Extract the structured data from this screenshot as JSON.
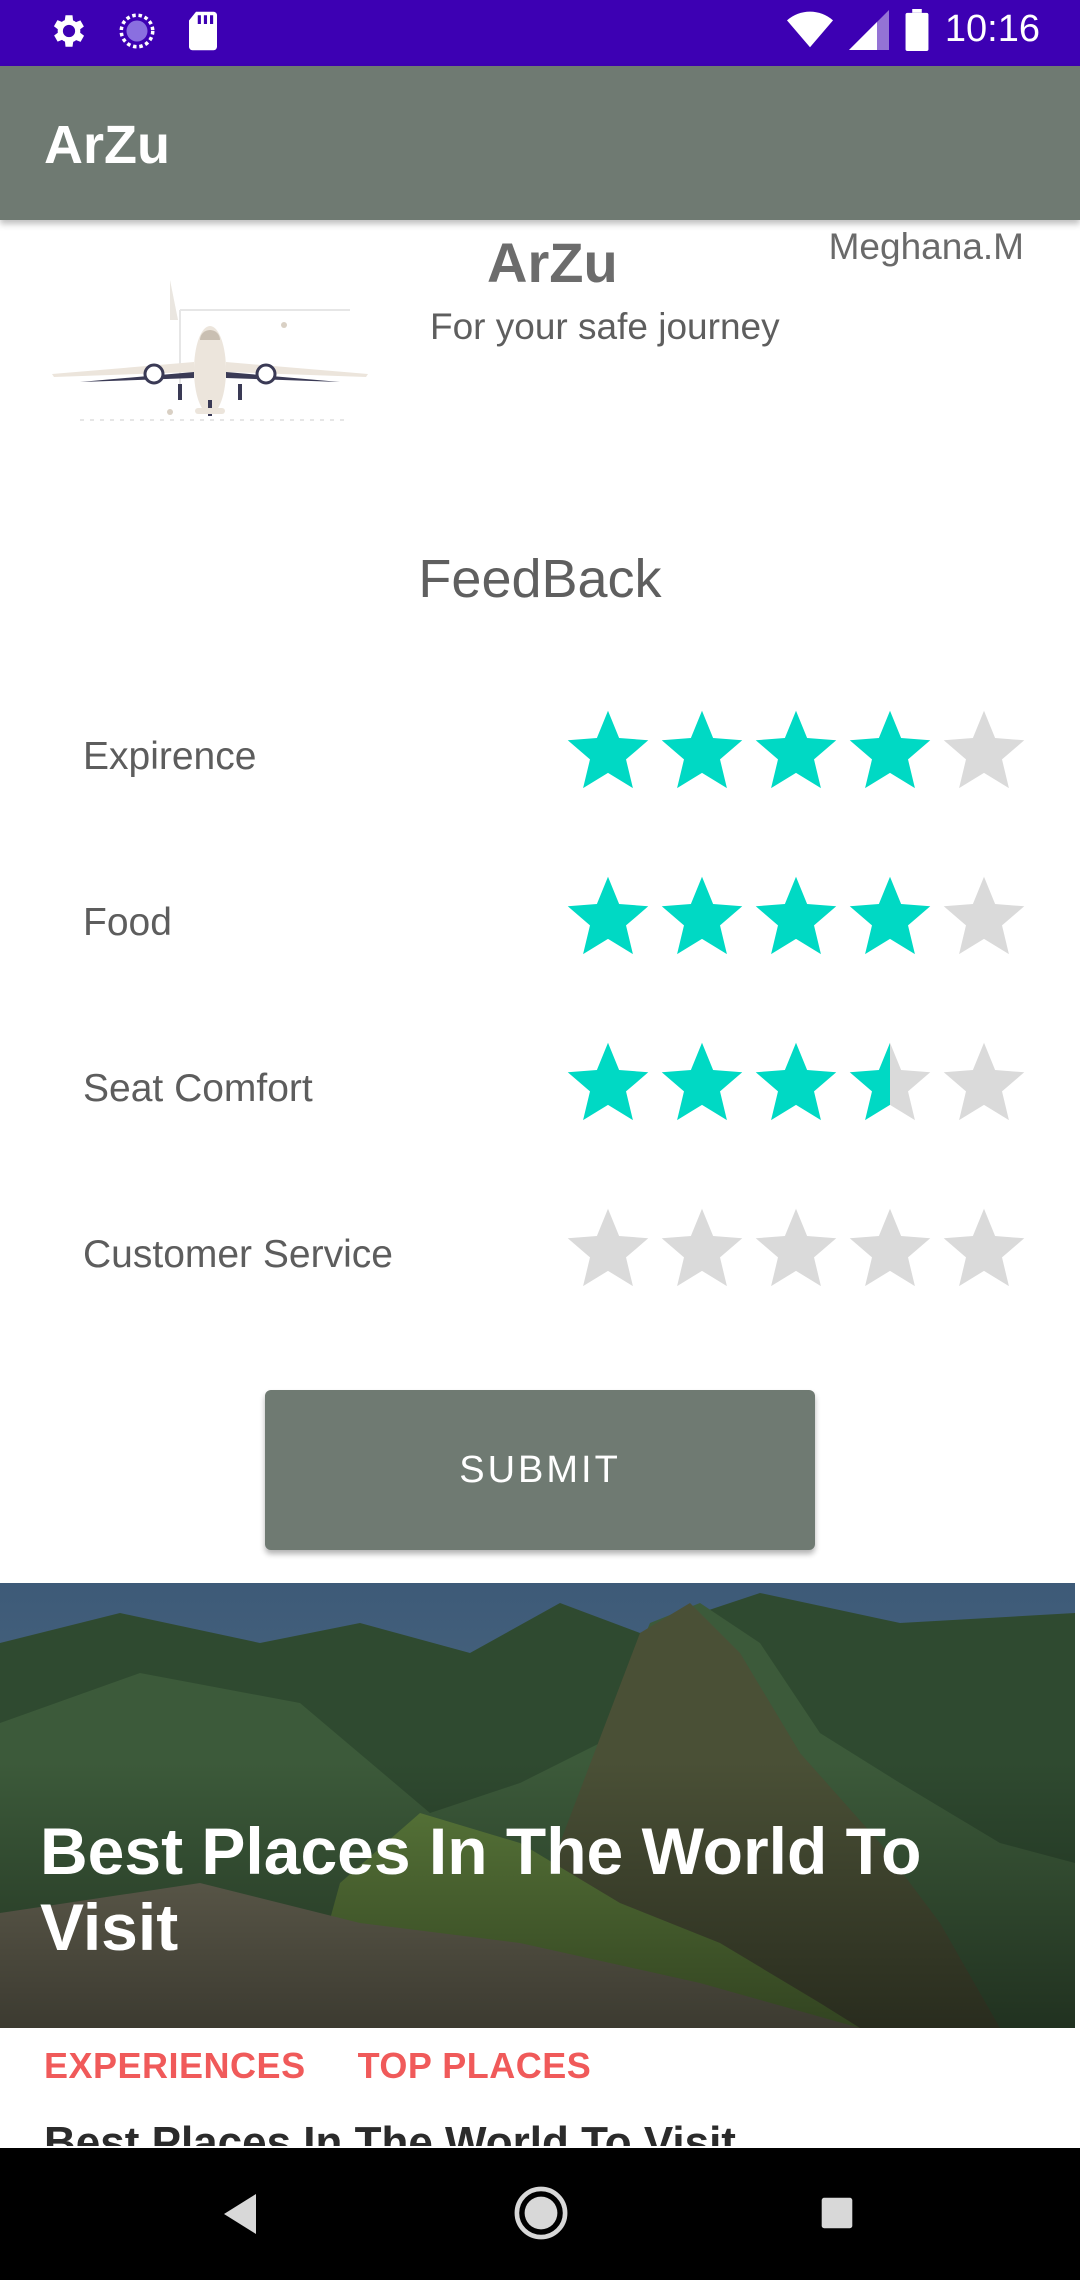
{
  "status": {
    "time": "10:16"
  },
  "app_bar": {
    "title": "ArZu"
  },
  "header": {
    "brand": "ArZu",
    "tagline": "For your safe journey",
    "author": "Meghana.M"
  },
  "feedback": {
    "title": "FeedBack",
    "ratings": [
      {
        "label": "Expirence",
        "value": 4,
        "max": 5
      },
      {
        "label": "Food",
        "value": 4,
        "max": 5
      },
      {
        "label": "Seat Comfort",
        "value": 3.5,
        "max": 5
      },
      {
        "label": "Customer Service",
        "value": 0,
        "max": 5
      }
    ],
    "submit_label": "SUBMIT"
  },
  "card": {
    "hero_title": "Best Places In The World To Visit",
    "tabs": [
      "EXPERIENCES",
      "TOP PLACES"
    ],
    "peek_text": "Best Places In The World To Visit"
  },
  "colors": {
    "accent_star": "#00d9c4",
    "empty_star": "#dadada",
    "app_bar": "#6f7a72",
    "status_bar": "#3d00b3",
    "tab": "#f05a5a"
  }
}
